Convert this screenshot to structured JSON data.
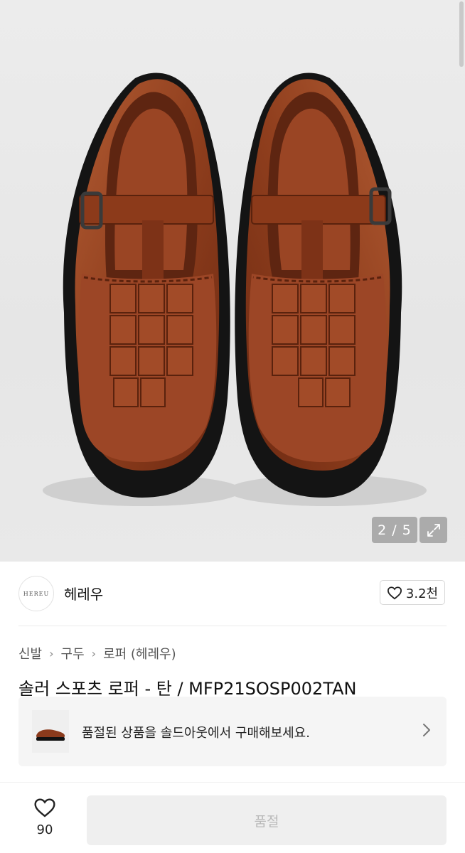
{
  "gallery": {
    "pager_text": "2 / 5",
    "current_image": 2,
    "total_images": 5
  },
  "brand": {
    "logo_text": "HEREU",
    "name": "헤레우",
    "like_count": "3.2천"
  },
  "breadcrumb": [
    "신발",
    "구두",
    "로퍼 (헤레우)"
  ],
  "product": {
    "title": "솔러 스포츠 로퍼 - 탄 / MFP21SOSP002TAN"
  },
  "sold_banner": {
    "text": "품절된 상품을 솔드아웃에서 구매해보세요."
  },
  "bottom_bar": {
    "like_count": "90",
    "action_label": "품절"
  },
  "colors": {
    "leather": "#8a3a1c",
    "sole": "#111111",
    "button_disabled_bg": "#efefef",
    "button_disabled_text": "#b9b9b9"
  },
  "icons": {
    "heart": "heart-icon",
    "expand": "expand-icon",
    "chevron": "chevron-right-icon"
  }
}
